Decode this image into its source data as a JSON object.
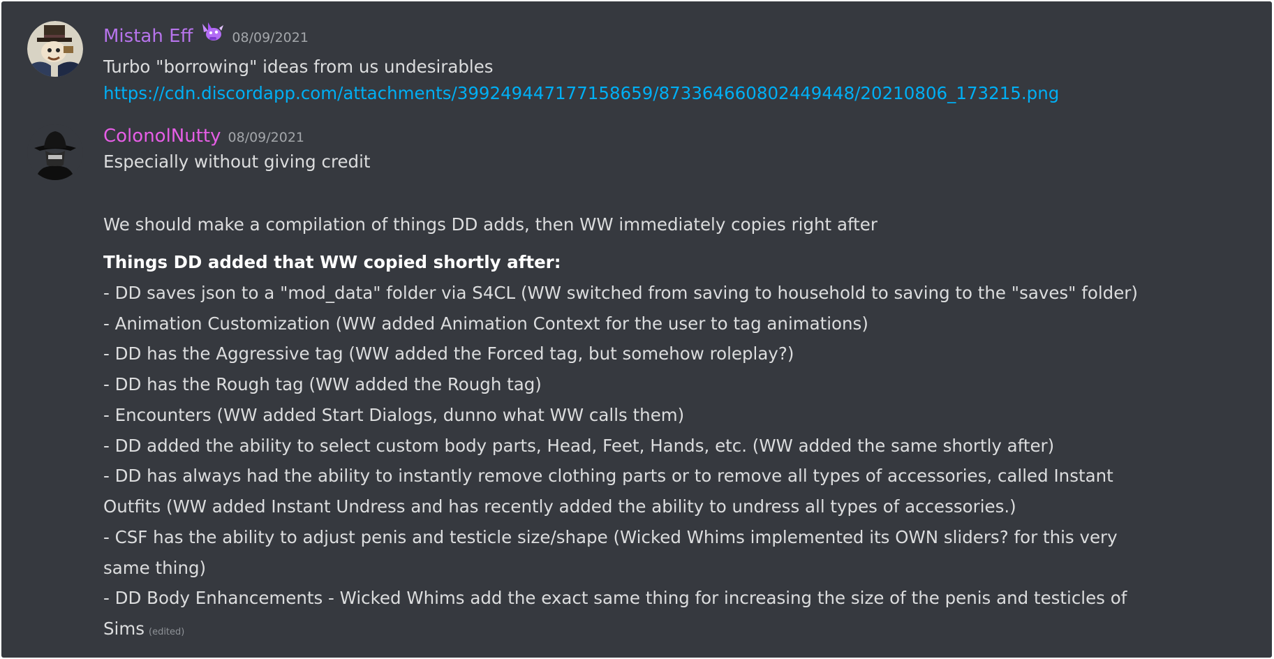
{
  "messages": [
    {
      "username": "Mistah Eff",
      "username_color": "#b774ec",
      "timestamp": "08/09/2021",
      "avatar_icon": "top-hat-character-avatar",
      "badge_icon": "purple-bunny-badge-icon",
      "lines": [
        "Turbo \"borrowing\" ideas from us undesirables"
      ],
      "link": "https://cdn.discordapp.com/attachments/399249447177158659/873364660802449448/20210806_173215.png"
    },
    {
      "username": "ColonolNutty",
      "username_color": "#e65ee6",
      "timestamp": "08/09/2021",
      "avatar_icon": "hooded-silhouette-avatar",
      "paragraphs": [
        "Especially without giving credit",
        "We should make a compilation of things DD adds, then WW immediately copies right after"
      ],
      "list_heading": "Things DD added that WW copied shortly after:",
      "list_lines": [
        "- DD saves json to a \"mod_data\" folder via S4CL (WW switched from saving to household to saving to the \"saves\" folder)",
        "- Animation Customization (WW added Animation Context for the user to tag animations)",
        "- DD has the Aggressive tag (WW added the Forced tag, but somehow roleplay?)",
        "- DD has the Rough tag (WW added the Rough tag)",
        "- Encounters (WW added Start Dialogs, dunno what WW calls them)",
        "- DD added the ability to select custom body parts, Head, Feet, Hands, etc. (WW added the same shortly after)",
        "- DD has always had the ability to instantly remove clothing parts or to remove all types of accessories, called Instant",
        "Outfits (WW added Instant Undress and has recently added the ability to undress all types of accessories.)",
        "- CSF has the ability to adjust penis and testicle size/shape (Wicked Whims implemented its OWN sliders? for this very",
        "same thing)",
        "- DD Body Enhancements - Wicked Whims add the exact same thing for increasing the size of the penis and testicles of",
        "Sims"
      ],
      "edited_label": "(edited)"
    }
  ],
  "colors": {
    "background": "#36393f",
    "text": "#dcddde",
    "link": "#00aff4",
    "timestamp": "#a3a6aa"
  }
}
